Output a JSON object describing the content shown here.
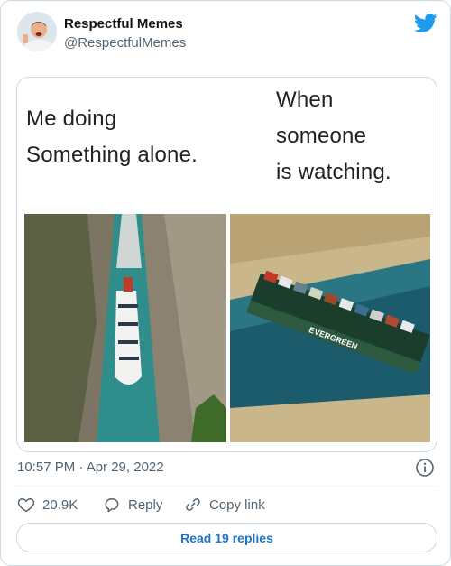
{
  "author": {
    "name": "Respectful Memes",
    "handle": "@RespectfulMemes"
  },
  "meme": {
    "left_caption": "Me doing\nSomething alone.",
    "right_caption": "When\nsomeone\nis watching.",
    "left_image": "cruise ship in narrow canal",
    "right_image": "container ship stuck in canal",
    "ship_text": "EVERGREEN"
  },
  "meta": {
    "timestamp": "10:57 PM · Apr 29, 2022"
  },
  "actions": {
    "likes": "20.9K",
    "reply_label": "Reply",
    "copy_label": "Copy link"
  },
  "read_replies_label": "Read 19 replies",
  "icons": {
    "logo": "twitter-bird-icon",
    "info": "info-icon",
    "like": "heart-icon",
    "reply": "reply-icon",
    "copy": "link-icon"
  },
  "colors": {
    "brand": "#1d9bf0",
    "link": "#1d74c7",
    "text": "#0f1419",
    "secondary": "#536471"
  }
}
